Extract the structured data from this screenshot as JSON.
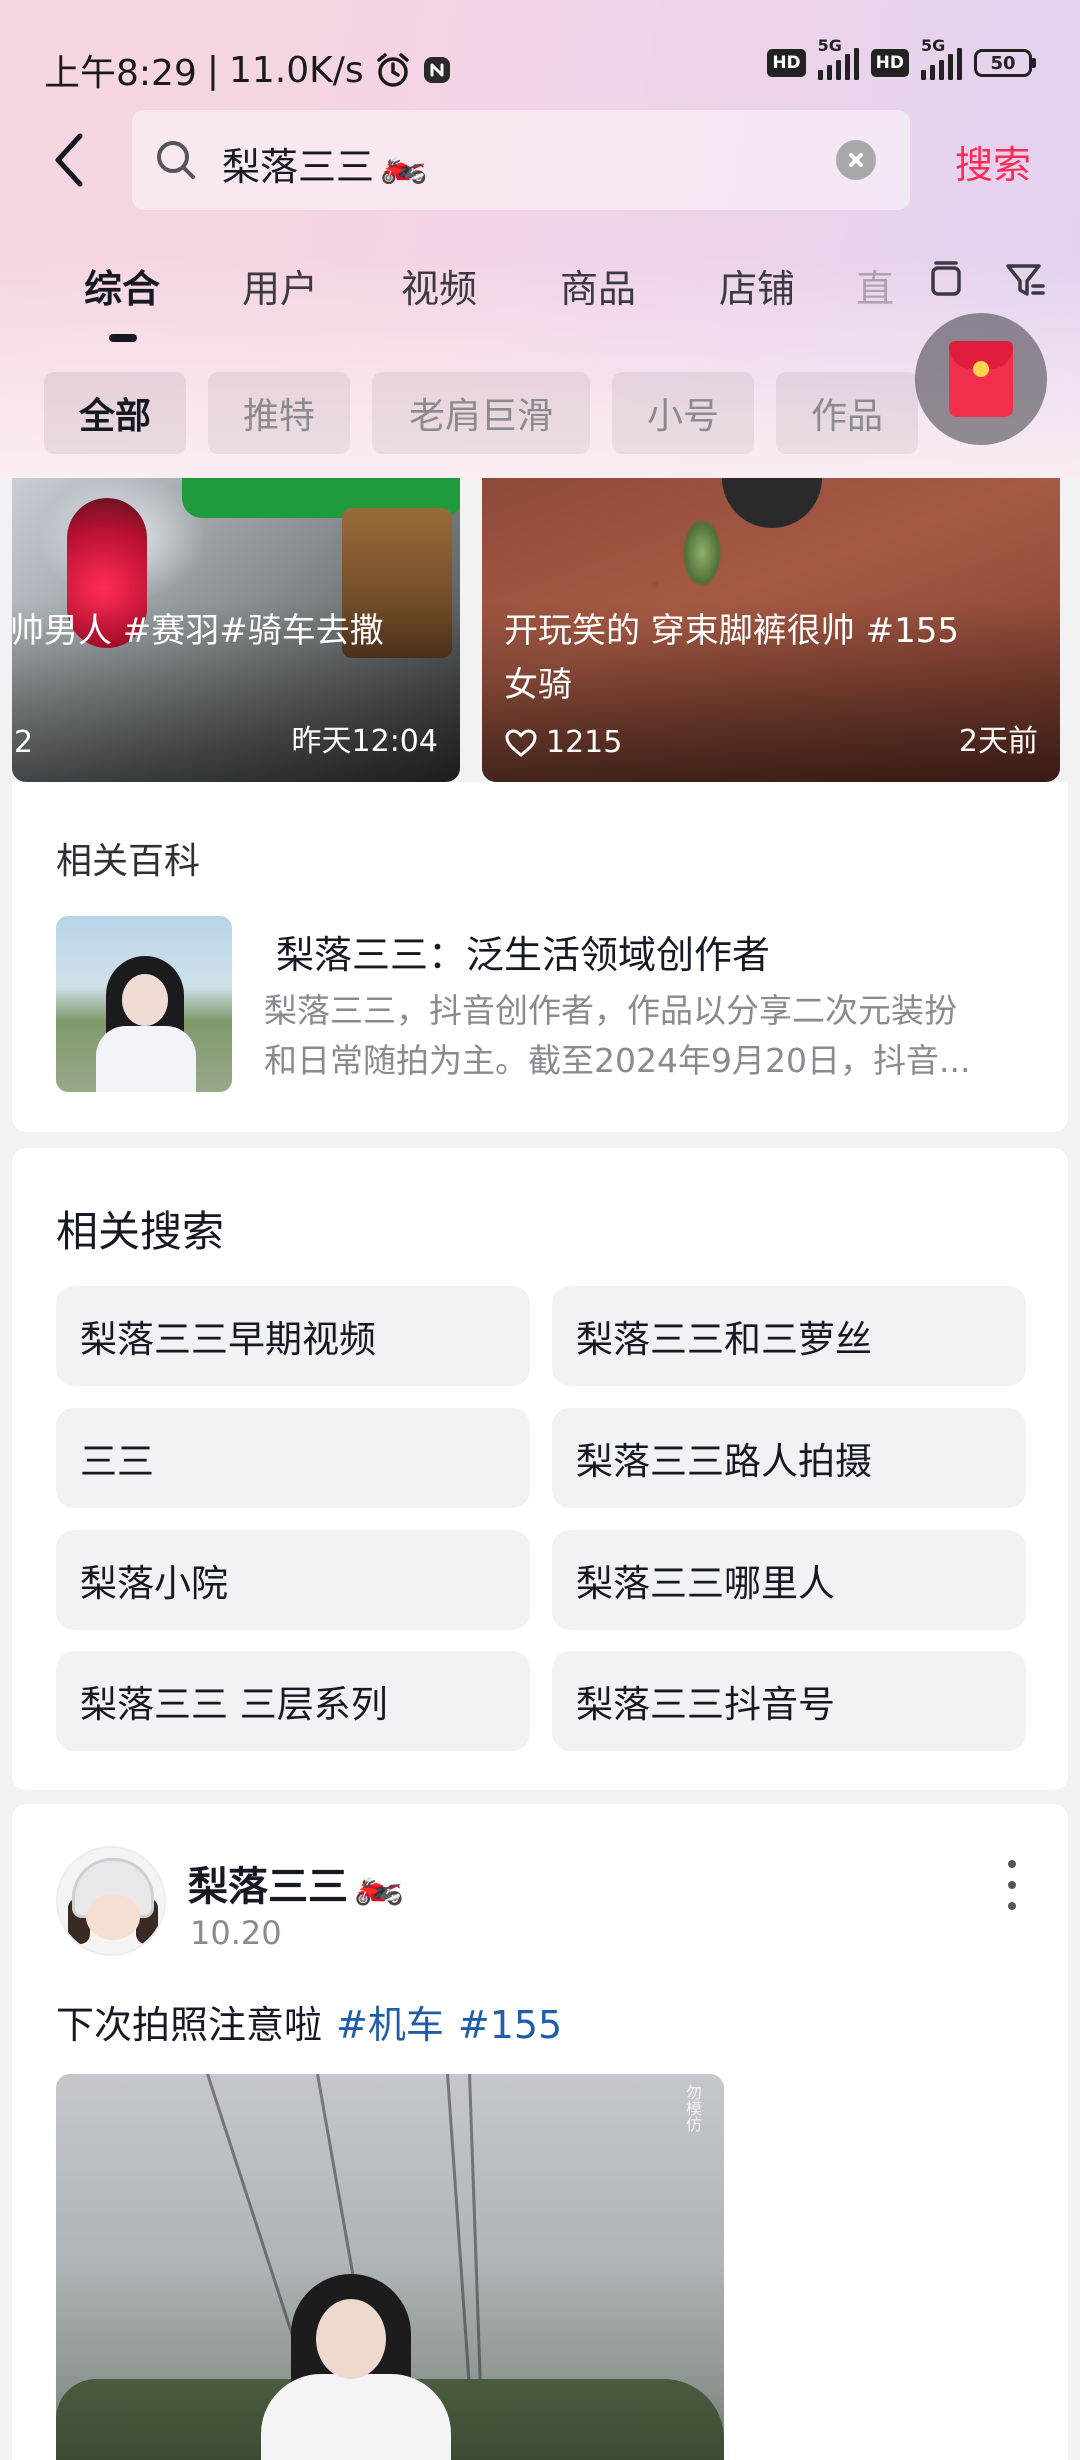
{
  "status_bar": {
    "time": "上午8:29",
    "separator": "|",
    "net_speed": "11.0K/s",
    "sim1_label": "HD",
    "sim1_net": "5G",
    "sim2_label": "HD",
    "sim2_net": "5G",
    "battery": "50"
  },
  "search": {
    "query": "梨落三三",
    "query_emoji": "🏍️",
    "action_label": "搜索"
  },
  "tabs": [
    "综合",
    "用户",
    "视频",
    "商品",
    "店铺",
    "直"
  ],
  "active_tab": 0,
  "chips": [
    "全部",
    "推特",
    "老肩巨滑",
    "小号",
    "作品"
  ],
  "active_chip": 0,
  "videos": [
    {
      "caption_line1": "帅男人 #赛羽#骑车去撒",
      "likes_fragment": "2",
      "time": "昨天12:04"
    },
    {
      "caption_line1": "开玩笑的 穿束脚裤很帅 #155",
      "caption_line2": "女骑",
      "likes": "1215",
      "time": "2天前"
    }
  ],
  "wiki": {
    "heading": "相关百科",
    "title": "梨落三三：泛生活领域创作者",
    "desc_line1": "梨落三三，抖音创作者，作品以分享二次元装扮",
    "desc_line2": "和日常随拍为主。截至2024年9月20日，抖音..."
  },
  "related": {
    "heading": "相关搜索",
    "items": [
      "梨落三三早期视频",
      "梨落三三和三萝丝",
      "三三",
      "梨落三三路人拍摄",
      "梨落小院",
      "梨落三三哪里人",
      "梨落三三 三层系列",
      "梨落三三抖音号"
    ]
  },
  "post": {
    "username": "梨落三三",
    "username_emoji": "🏍️",
    "date": "10.20",
    "text": "下次拍照注意啦",
    "tags": [
      "#机车",
      "#155"
    ],
    "watermark": "勿模仿"
  },
  "colors": {
    "accent": "#fe2c55",
    "hashtag": "#1f5ea8",
    "header_gradient_start": "#f6d6df",
    "header_gradient_end": "#e2d2f0"
  },
  "icons": {
    "status": [
      "alarm-icon",
      "nfc-icon",
      "signal-icon",
      "battery-icon"
    ],
    "header": [
      "back-icon",
      "search-icon",
      "clear-icon",
      "layout-icon",
      "filter-icon",
      "red-packet-icon"
    ],
    "cards": [
      "heart-icon",
      "more-icon"
    ]
  }
}
